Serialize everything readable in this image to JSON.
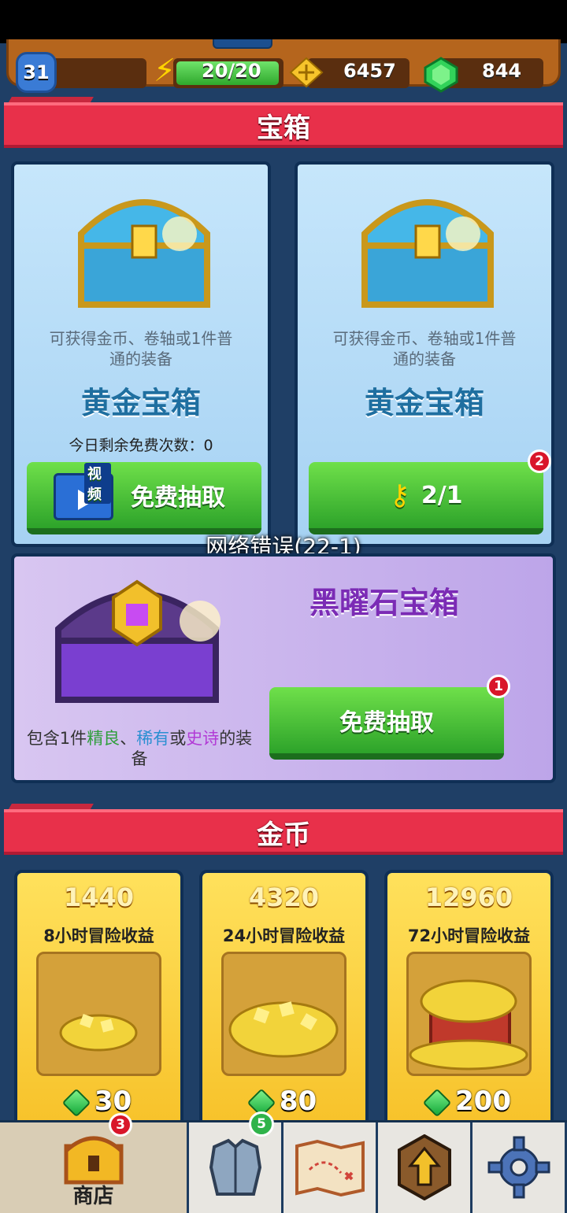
{
  "hud": {
    "level": "31",
    "energy": "20/20",
    "scrolls": "6457",
    "gems": "844"
  },
  "sections": {
    "chests_title": "宝箱",
    "coins_title": "金币"
  },
  "chest_cards": [
    {
      "description_line1": "可获得金币、卷轴或1件普",
      "description_line2": "通的装备",
      "title": "黄金宝箱",
      "remaining": "今日剩余免费次数：0",
      "video_tag": "视频",
      "button_label": "免费抽取"
    },
    {
      "description_line1": "可获得金币、卷轴或1件普",
      "description_line2": "通的装备",
      "title": "黄金宝箱",
      "button_label": "2/1",
      "badge": "2"
    }
  ],
  "toast": "网络错误(22-1)",
  "obsidian": {
    "title": "黑曜石宝箱",
    "desc_prefix": "包含1件",
    "fine": "精良",
    "sep1": "、",
    "rare": "稀有",
    "sep2": "或",
    "epic": "史诗",
    "desc_suffix_line1": "的装",
    "desc_line2": "备",
    "button_label": "免费抽取",
    "badge": "1"
  },
  "coin_offers": [
    {
      "amount": "1440",
      "label": "8小时冒险收益",
      "price": "30"
    },
    {
      "amount": "4320",
      "label": "24小时冒险收益",
      "price": "80"
    },
    {
      "amount": "12960",
      "label": "72小时冒险收益",
      "price": "200"
    }
  ],
  "nav": {
    "shop_label": "商店",
    "shop_badge": "3",
    "gear_badge": "5"
  },
  "colors": {
    "banner_red": "#e8304a",
    "button_green": "#2da32a",
    "fine_green": "#2e9e3a",
    "rare_blue": "#2b8fd1",
    "epic_purple": "#b23bd6",
    "obsidian_title": "#7b2bb5"
  },
  "icons": [
    "energy-bolt-icon",
    "scroll-icon",
    "gem-icon",
    "video-icon",
    "key-icon",
    "armor-icon",
    "map-icon",
    "upgrade-arrow-icon",
    "gear-icon",
    "chest-icon"
  ]
}
